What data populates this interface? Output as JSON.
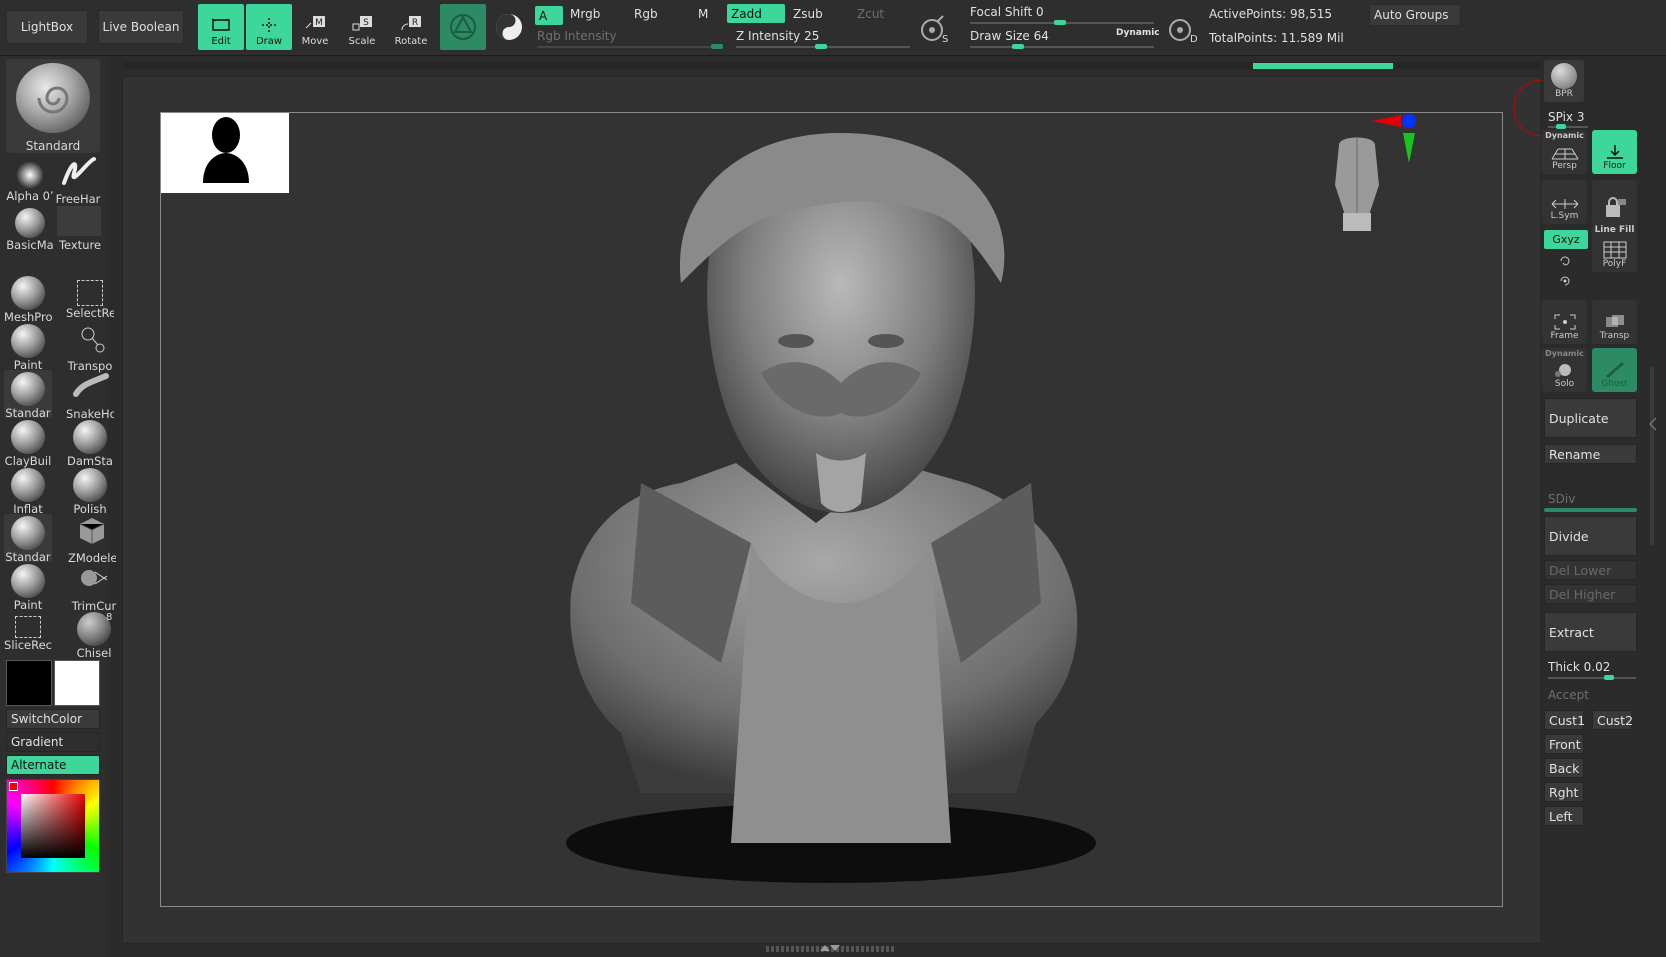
{
  "topbar": {
    "lightbox": "LightBox",
    "live_boolean": "Live Boolean",
    "tools": {
      "edit": "Edit",
      "draw": "Draw",
      "move": "Move",
      "scale": "Scale",
      "rotate": "Rotate"
    },
    "move_key": "M",
    "scale_key": "S",
    "rotate_key": "R",
    "a_label": "A",
    "mrgb": "Mrgb",
    "rgb": "Rgb",
    "m": "M",
    "zadd": "Zadd",
    "zsub": "Zsub",
    "zcut": "Zcut",
    "rgb_intensity": "Rgb Intensity",
    "z_intensity_label": "Z Intensity",
    "z_intensity_value": "25",
    "s_key": "S",
    "d_key": "D",
    "focal_shift_label": "Focal Shift",
    "focal_shift_value": "0",
    "draw_size_label": "Draw Size",
    "draw_size_value": "64",
    "dynamic": "Dynamic",
    "active_points": "ActivePoints: 98,515",
    "total_points": "TotalPoints: 11.589 Mil",
    "auto_groups": "Auto Groups"
  },
  "left": {
    "current_brush": "Standard",
    "alpha": "Alpha 0ʼ",
    "stroke": "FreeHar",
    "material": "BasicMa",
    "texture": "Texture",
    "brushes": [
      {
        "label": "MeshPro"
      },
      {
        "label": "SelectRe"
      },
      {
        "label": "Paint"
      },
      {
        "label": "Transpo"
      },
      {
        "label": "Standar"
      },
      {
        "label": "SnakeHo"
      },
      {
        "label": "ClayBuil"
      },
      {
        "label": "DamSta"
      },
      {
        "label": "Inflat"
      },
      {
        "label": "Polish"
      },
      {
        "label": "Standar"
      },
      {
        "label": "ZModele"
      },
      {
        "label": "Paint"
      },
      {
        "label": "TrimCur"
      },
      {
        "label": "SliceRec"
      },
      {
        "label": "Chisel"
      }
    ],
    "chisel_badge": "8",
    "switch_color": "SwitchColor",
    "gradient": "Gradient",
    "alternate": "Alternate"
  },
  "right": {
    "bpr": "BPR",
    "spix": "SPix 3",
    "dynamic": "Dynamic",
    "persp": "Persp",
    "floor": "Floor",
    "lsym": "L.Sym",
    "xyz": "Gxyz",
    "line_fill": "Line Fill",
    "polyf": "PolyF",
    "frame": "Frame",
    "transp": "Transp",
    "dynamic2": "Dynamic",
    "solo": "Solo",
    "ghost": "Ghost",
    "duplicate": "Duplicate",
    "rename": "Rename",
    "sdiv": "SDiv",
    "divide": "Divide",
    "del_lower": "Del Lower",
    "del_higher": "Del Higher",
    "extract": "Extract",
    "thick": "Thick 0.02",
    "accept": "Accept",
    "cust1": "Cust1",
    "cust2": "Cust2",
    "front": "Front",
    "back": "Back",
    "rght": "Rght",
    "left": "Left"
  },
  "colors": {
    "accent": "#3ed79b",
    "bg": "#2b2b2b",
    "panel": "#2e2e2e"
  }
}
